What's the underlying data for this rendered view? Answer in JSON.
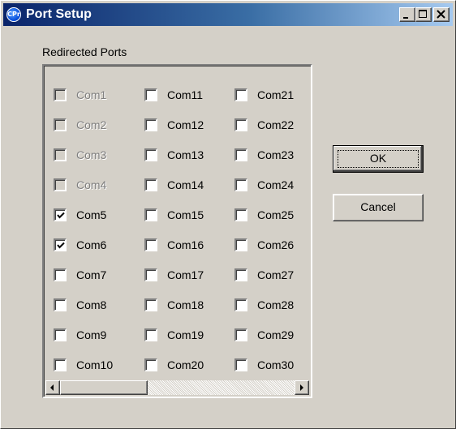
{
  "window": {
    "title": "Port Setup",
    "icon_name": "cpr-app-icon",
    "icon_text": "CPr",
    "controls": [
      "minimize-icon",
      "maximize-icon",
      "close-icon"
    ]
  },
  "group": {
    "label": "Redirected Ports",
    "ports": [
      {
        "label": "Com1",
        "checked": false,
        "enabled": false
      },
      {
        "label": "Com2",
        "checked": false,
        "enabled": false
      },
      {
        "label": "Com3",
        "checked": false,
        "enabled": false
      },
      {
        "label": "Com4",
        "checked": false,
        "enabled": false
      },
      {
        "label": "Com5",
        "checked": true,
        "enabled": true
      },
      {
        "label": "Com6",
        "checked": true,
        "enabled": true
      },
      {
        "label": "Com7",
        "checked": false,
        "enabled": true
      },
      {
        "label": "Com8",
        "checked": false,
        "enabled": true
      },
      {
        "label": "Com9",
        "checked": false,
        "enabled": true
      },
      {
        "label": "Com10",
        "checked": false,
        "enabled": true
      },
      {
        "label": "Com11",
        "checked": false,
        "enabled": true
      },
      {
        "label": "Com12",
        "checked": false,
        "enabled": true
      },
      {
        "label": "Com13",
        "checked": false,
        "enabled": true
      },
      {
        "label": "Com14",
        "checked": false,
        "enabled": true
      },
      {
        "label": "Com15",
        "checked": false,
        "enabled": true
      },
      {
        "label": "Com16",
        "checked": false,
        "enabled": true
      },
      {
        "label": "Com17",
        "checked": false,
        "enabled": true
      },
      {
        "label": "Com18",
        "checked": false,
        "enabled": true
      },
      {
        "label": "Com19",
        "checked": false,
        "enabled": true
      },
      {
        "label": "Com20",
        "checked": false,
        "enabled": true
      },
      {
        "label": "Com21",
        "checked": false,
        "enabled": true
      },
      {
        "label": "Com22",
        "checked": false,
        "enabled": true
      },
      {
        "label": "Com23",
        "checked": false,
        "enabled": true
      },
      {
        "label": "Com24",
        "checked": false,
        "enabled": true
      },
      {
        "label": "Com25",
        "checked": false,
        "enabled": true
      },
      {
        "label": "Com26",
        "checked": false,
        "enabled": true
      },
      {
        "label": "Com27",
        "checked": false,
        "enabled": true
      },
      {
        "label": "Com28",
        "checked": false,
        "enabled": true
      },
      {
        "label": "Com29",
        "checked": false,
        "enabled": true
      },
      {
        "label": "Com30",
        "checked": false,
        "enabled": true
      }
    ],
    "scrollbar": {
      "left_icon": "scroll-left-arrow-icon",
      "right_icon": "scroll-right-arrow-icon"
    }
  },
  "buttons": {
    "ok_label": "OK",
    "cancel_label": "Cancel"
  },
  "colors": {
    "face": "#d4d0c8",
    "title_start": "#0a246a",
    "title_end": "#a6caf0"
  }
}
